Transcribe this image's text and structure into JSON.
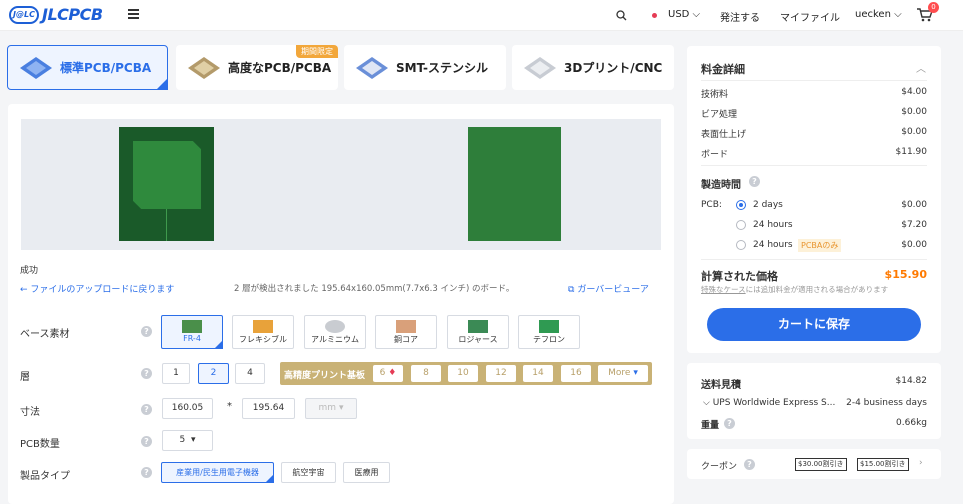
{
  "header": {
    "logo_badge": "J@LC",
    "logo_text": "JLCPCB",
    "currency": "USD",
    "order": "発注する",
    "my_files": "マイファイル",
    "user": "uecken",
    "cart_count": "0"
  },
  "tabs": [
    {
      "label": "標準PCB/PCBA"
    },
    {
      "label": "高度なPCB/PCBA",
      "promo": "期間限定"
    },
    {
      "label": "SMT-ステンシル"
    },
    {
      "label": "3Dプリント/CNC"
    }
  ],
  "upload": {
    "status": "成功",
    "back_link": "ファイルのアップロードに戻ります",
    "detect_text": "2 層が検出されました 195.64x160.05mm(7.7x6.3 インチ) のボード。",
    "gerber_viewer": "ガーバービューア"
  },
  "form": {
    "base_material_label": "ベース素材",
    "materials": [
      "FR-4",
      "フレキシブル",
      "アルミニウム",
      "銅コア",
      "ロジャース",
      "テフロン"
    ],
    "layers_label": "層",
    "layers": [
      "1",
      "2",
      "4"
    ],
    "hd_label": "高精度プリント基板",
    "hd_layers": [
      "6",
      "8",
      "10",
      "12",
      "14",
      "16"
    ],
    "more": "More",
    "dimension_label": "寸法",
    "dim_x": "160.05",
    "dim_sep": "*",
    "dim_y": "195.64",
    "dim_unit": "mm",
    "qty_label": "PCB数量",
    "qty": "5",
    "product_type_label": "製品タイプ",
    "product_types": [
      "産業用/民生用電子機器",
      "航空宇宙",
      "医療用"
    ]
  },
  "pricing": {
    "title": "料金詳細",
    "rows": [
      {
        "name": "技術料",
        "value": "$4.00"
      },
      {
        "name": "ビア処理",
        "value": "$0.00"
      },
      {
        "name": "表面仕上げ",
        "value": "$0.00"
      },
      {
        "name": "ボード",
        "value": "$11.90"
      }
    ],
    "build_time_title": "製造時間",
    "pcb_label": "PCB:",
    "options": [
      {
        "label": "2 days",
        "value": "$0.00"
      },
      {
        "label": "24 hours",
        "value": "$7.20"
      },
      {
        "label": "24 hours",
        "tag": "PCBAのみ",
        "value": "$0.00"
      }
    ],
    "calc_title": "計算された価格",
    "calc_value": "$15.90",
    "special_case": "特殊なケース",
    "special_note": "には追加料金が適用される場合があります",
    "save_btn": "カートに保存"
  },
  "shipping": {
    "title": "送料見積",
    "cost": "$14.82",
    "method": "UPS Worldwide Express S...",
    "days": "2-4 business days",
    "weight_label": "重量",
    "weight": "0.66kg"
  },
  "coupon": {
    "label": "クーポン",
    "tags": [
      "$30.00割引き",
      "$15.00割引き"
    ]
  }
}
